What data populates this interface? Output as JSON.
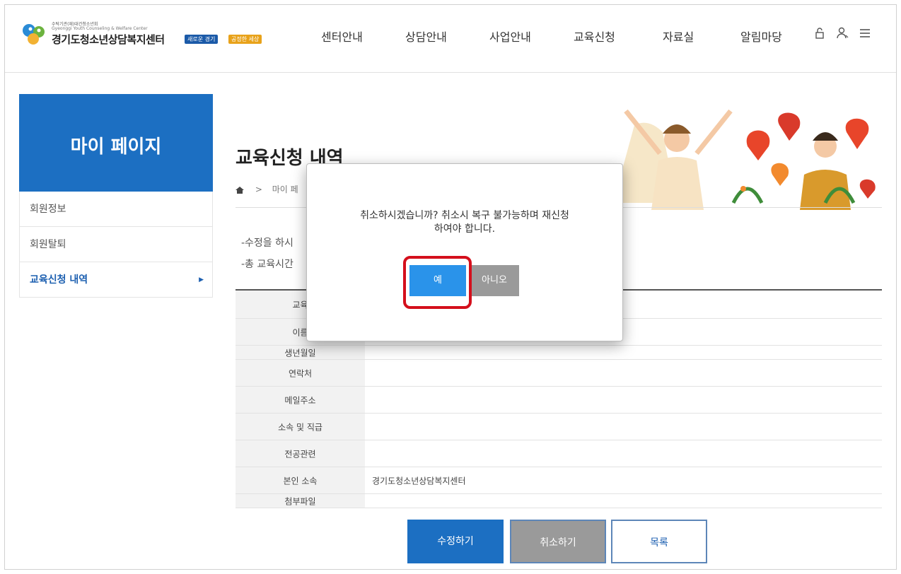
{
  "header": {
    "logo_sub1": "수탁기관(재)대건청소년회",
    "logo_sub2": "Gyeonggi Youth Counseling & Welfare Center",
    "logo_title": "경기도청소년상담복지센터",
    "badge1": "새로운 경기",
    "badge2": "공정한 세상",
    "nav": [
      "센터안내",
      "상담안내",
      "사업안내",
      "교육신청",
      "자료실",
      "알림마당"
    ],
    "icons": [
      "lock-icon",
      "user-icon",
      "menu-icon"
    ]
  },
  "sidebar": {
    "title": "마이 페이지",
    "items": [
      {
        "label": "회원정보"
      },
      {
        "label": "회원탈퇴"
      },
      {
        "label": "교육신청 내역",
        "active": true
      }
    ]
  },
  "main": {
    "title": "교육신청 내역",
    "breadcrumb": [
      "마이 페"
    ],
    "notes": [
      "-수정을 하시",
      "-총 교육시간"
    ],
    "table": [
      {
        "label": "교육",
        "value": ""
      },
      {
        "label": "이름",
        "value": ""
      },
      {
        "label": "생년월일",
        "value": ""
      },
      {
        "label": "연락처",
        "value": ""
      },
      {
        "label": "메일주소",
        "value": ""
      },
      {
        "label": "소속 및 직급",
        "value": ""
      },
      {
        "label": "전공관련",
        "value": ""
      },
      {
        "label": "본인 소속",
        "value": "경기도청소년상담복지센터"
      },
      {
        "label": "첨부파일",
        "value": ""
      }
    ],
    "buttons": {
      "edit": "수정하기",
      "cancel": "취소하기",
      "list": "목록"
    }
  },
  "dialog": {
    "message_line1": "취소하시겠습니까? 취소시 복구 불가능하며 재신청",
    "message_line2": "하여야 합니다.",
    "yes": "예",
    "no": "아니오"
  },
  "colors": {
    "primary": "#1c6fc2",
    "dialog_yes": "#2a93ea",
    "highlight": "#d40f1c",
    "gray_button": "#9a9a9a"
  }
}
